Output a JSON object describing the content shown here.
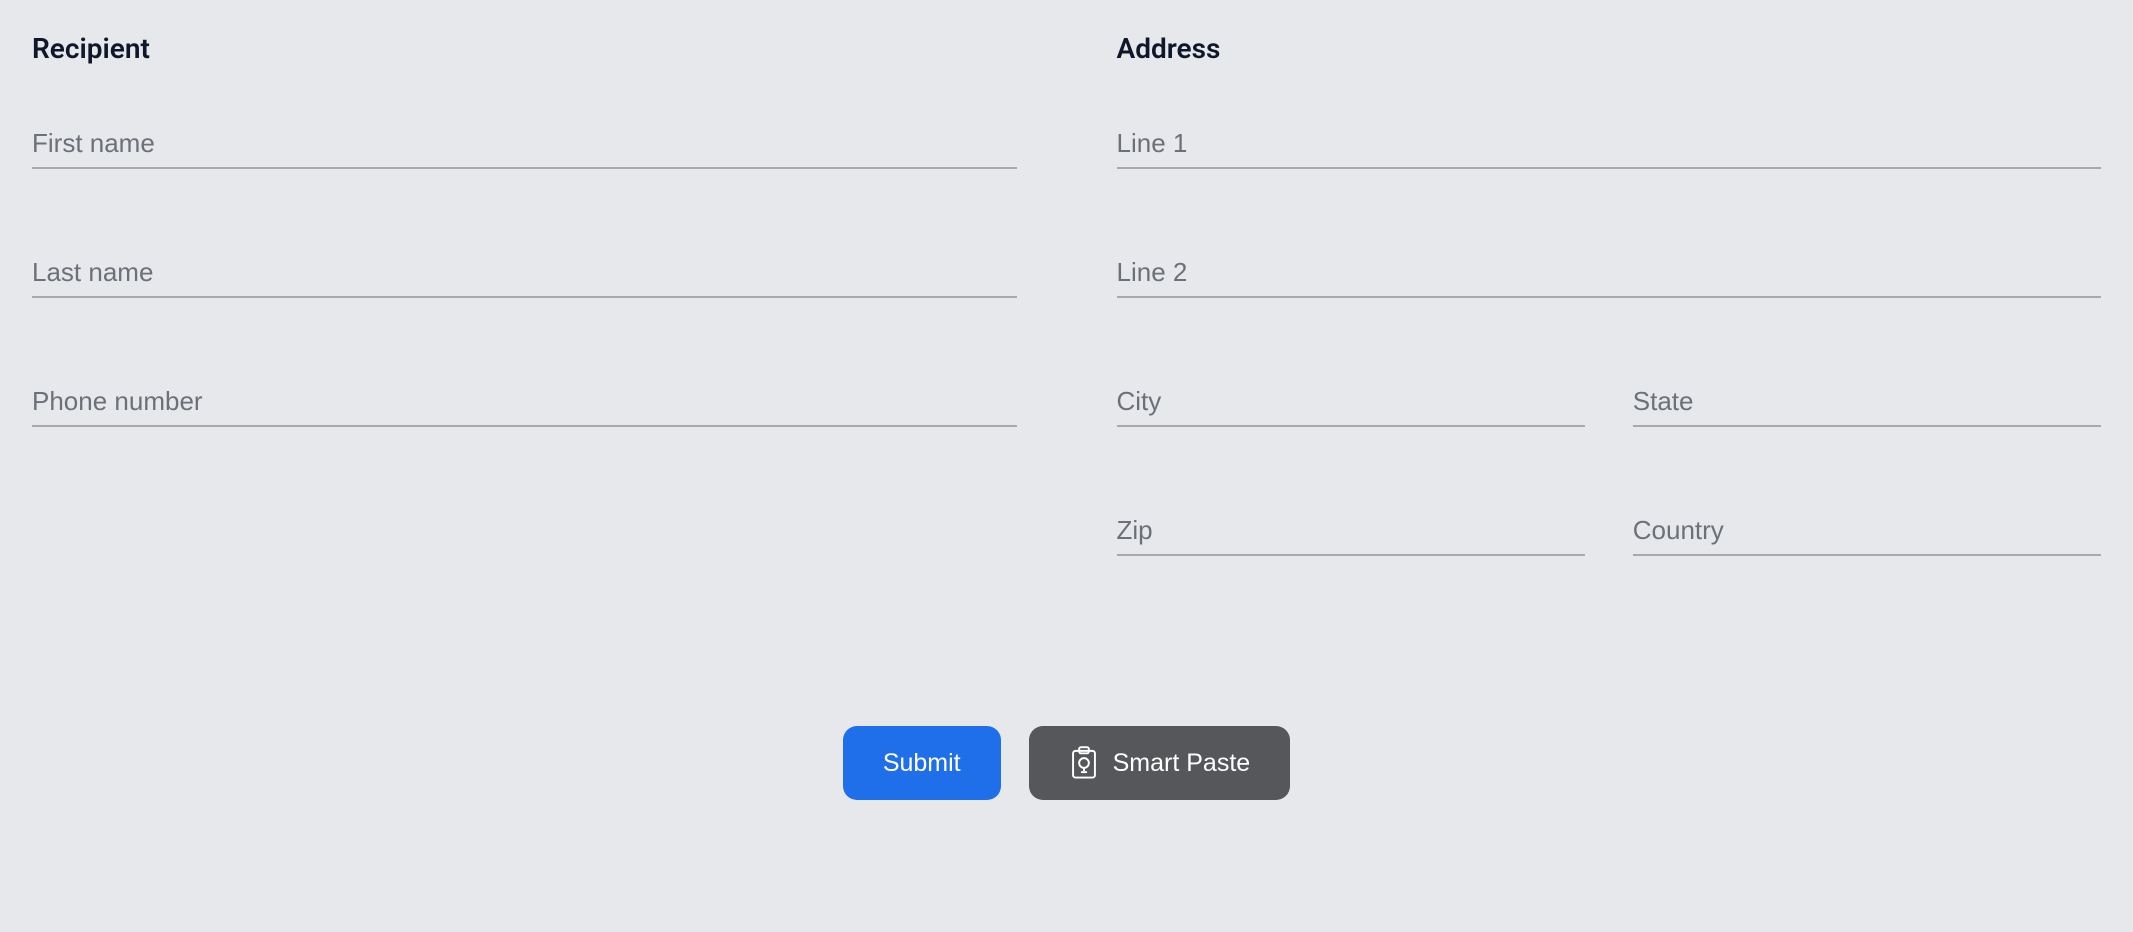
{
  "recipient": {
    "heading": "Recipient",
    "first_name_placeholder": "First name",
    "last_name_placeholder": "Last name",
    "phone_placeholder": "Phone number"
  },
  "address": {
    "heading": "Address",
    "line1_placeholder": "Line 1",
    "line2_placeholder": "Line 2",
    "city_placeholder": "City",
    "state_placeholder": "State",
    "zip_placeholder": "Zip",
    "country_placeholder": "Country"
  },
  "buttons": {
    "submit_label": "Submit",
    "smart_paste_label": "Smart Paste"
  }
}
